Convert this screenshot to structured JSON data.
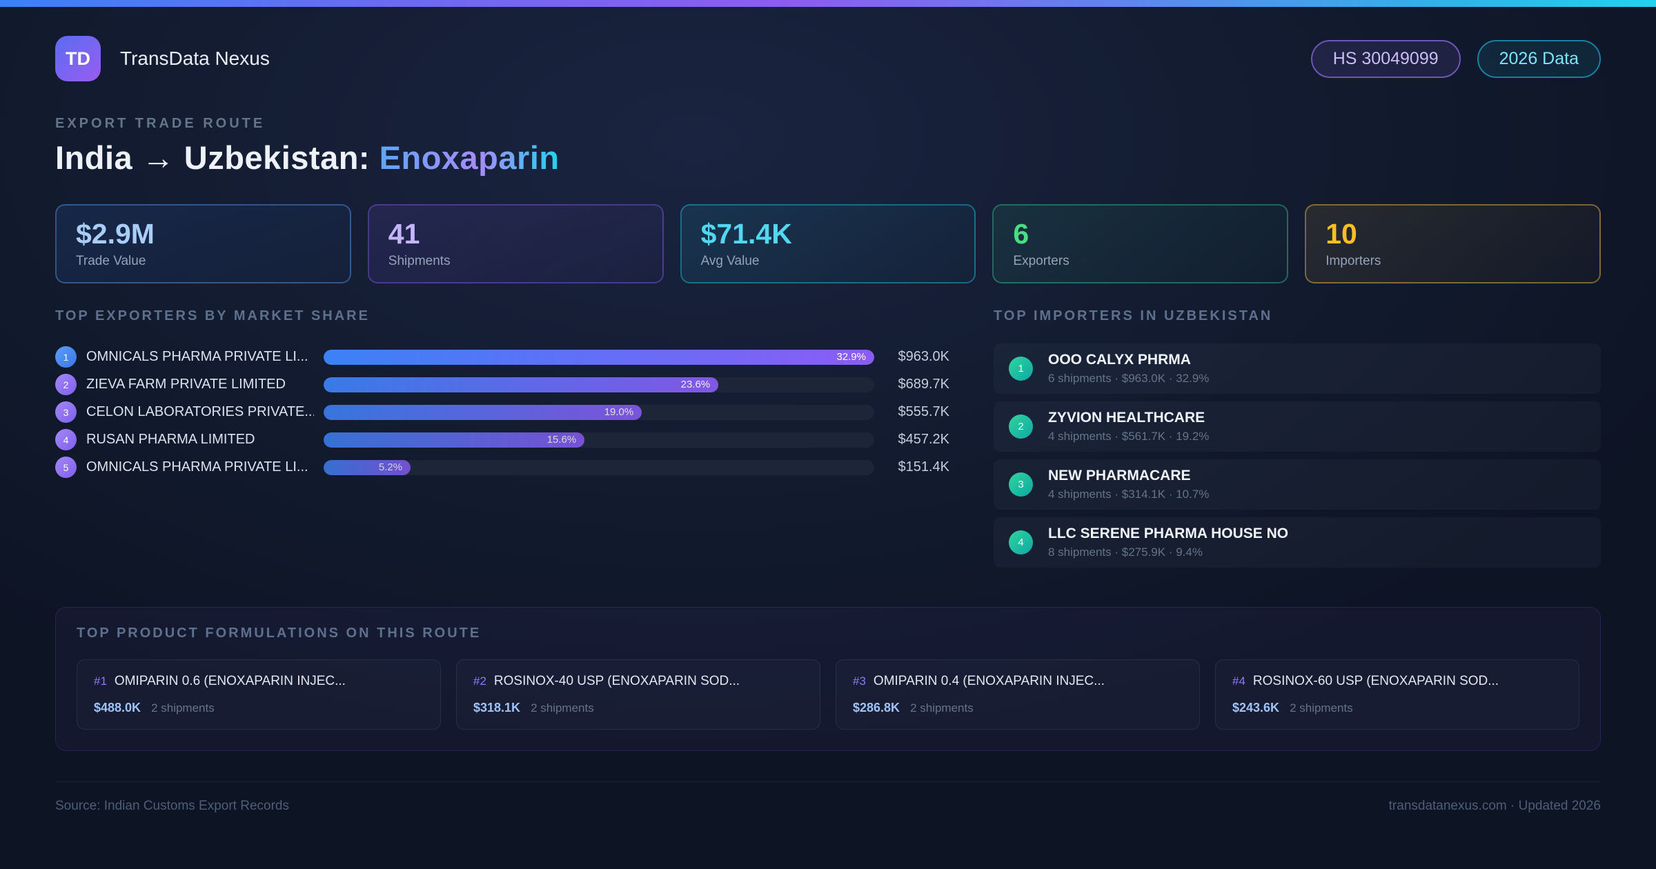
{
  "brand": {
    "logo_text": "TD",
    "name": "TransData Nexus"
  },
  "header_badges": {
    "hs_code": "HS 30049099",
    "data_year": "2026 Data"
  },
  "hero": {
    "eyebrow": "EXPORT TRADE ROUTE",
    "title_route": "India → Uzbekistan: ",
    "title_product": "Enoxaparin"
  },
  "stats": [
    {
      "value": "$2.9M",
      "label": "Trade Value",
      "accent": "#a8cdf8"
    },
    {
      "value": "41",
      "label": "Shipments",
      "accent": "#c4b5fd"
    },
    {
      "value": "$71.4K",
      "label": "Avg Value",
      "accent": "#53d6f0"
    },
    {
      "value": "6",
      "label": "Exporters",
      "accent": "#4ade80"
    },
    {
      "value": "10",
      "label": "Importers",
      "accent": "#fbbf24"
    }
  ],
  "exporters": {
    "heading": "TOP EXPORTERS BY MARKET SHARE",
    "rows": [
      {
        "rank": "1",
        "name": "OMNICALS PHARMA PRIVATE LI...",
        "pct": 32.9,
        "pct_label": "32.9%",
        "value": "$963.0K"
      },
      {
        "rank": "2",
        "name": "ZIEVA FARM PRIVATE LIMITED",
        "pct": 23.6,
        "pct_label": "23.6%",
        "value": "$689.7K"
      },
      {
        "rank": "3",
        "name": "CELON LABORATORIES PRIVATE...",
        "pct": 19.0,
        "pct_label": "19.0%",
        "value": "$555.7K"
      },
      {
        "rank": "4",
        "name": "RUSAN PHARMA LIMITED",
        "pct": 15.6,
        "pct_label": "15.6%",
        "value": "$457.2K"
      },
      {
        "rank": "5",
        "name": "OMNICALS PHARMA PRIVATE LI...",
        "pct": 5.2,
        "pct_label": "5.2%",
        "value": "$151.4K"
      }
    ]
  },
  "importers": {
    "heading": "TOP IMPORTERS IN UZBEKISTAN",
    "rows": [
      {
        "rank": "1",
        "name": "OOO CALYX PHRMA",
        "meta": "6 shipments · $963.0K · 32.9%"
      },
      {
        "rank": "2",
        "name": "ZYVION HEALTHCARE",
        "meta": "4 shipments · $561.7K · 19.2%"
      },
      {
        "rank": "3",
        "name": "NEW PHARMACARE",
        "meta": "4 shipments · $314.1K · 10.7%"
      },
      {
        "rank": "4",
        "name": "LLC SERENE PHARMA HOUSE NO",
        "meta": "8 shipments · $275.9K · 9.4%"
      }
    ]
  },
  "formulations": {
    "heading": "TOP PRODUCT FORMULATIONS ON THIS ROUTE",
    "cards": [
      {
        "rank": "#1",
        "name": "OMIPARIN 0.6 (ENOXAPARIN INJEC...",
        "value": "$488.0K",
        "shipments": "2 shipments"
      },
      {
        "rank": "#2",
        "name": "ROSINOX-40 USP (ENOXAPARIN SOD...",
        "value": "$318.1K",
        "shipments": "2 shipments"
      },
      {
        "rank": "#3",
        "name": "OMIPARIN 0.4 (ENOXAPARIN INJEC...",
        "value": "$286.8K",
        "shipments": "2 shipments"
      },
      {
        "rank": "#4",
        "name": "ROSINOX-60 USP (ENOXAPARIN SOD...",
        "value": "$243.6K",
        "shipments": "2 shipments"
      }
    ]
  },
  "footer": {
    "source": "Source: Indian Customs Export Records",
    "site": "transdatanexus.com · Updated 2026"
  },
  "colors": {
    "topbar_gradient": [
      "#3b82f6",
      "#8b5cf6",
      "#22d3ee"
    ],
    "bar_gradient": [
      "#3b82f6",
      "#8b5cf6"
    ],
    "importer_badge": [
      "#2fd49e",
      "#0fa8a3"
    ],
    "background": "#0d1424"
  }
}
